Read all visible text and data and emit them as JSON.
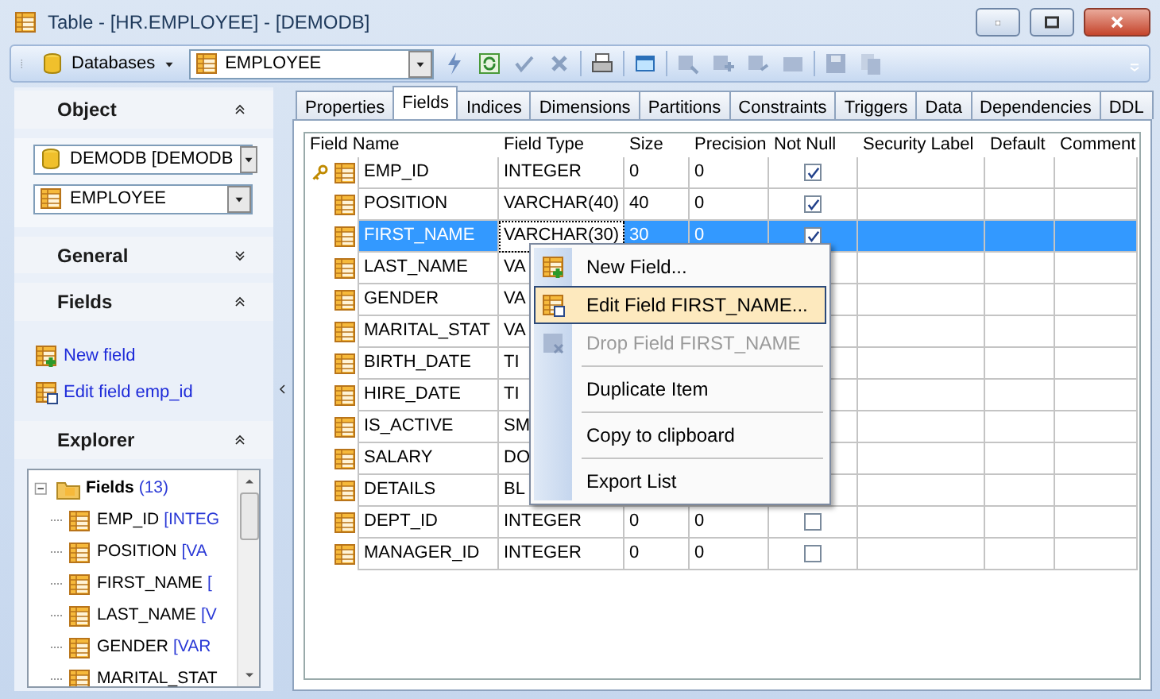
{
  "window": {
    "title": "Table - [HR.EMPLOYEE] - [DEMODB]"
  },
  "toolbar": {
    "databases_label": "Databases",
    "object_combo": "EMPLOYEE"
  },
  "sidebar": {
    "sections": [
      {
        "title": "Object",
        "expanded": true,
        "kind": "object",
        "combos": [
          "DEMODB [DEMODB",
          "EMPLOYEE"
        ]
      },
      {
        "title": "General",
        "expanded": false,
        "kind": "empty"
      },
      {
        "title": "Fields",
        "expanded": true,
        "kind": "links",
        "links": [
          "New field",
          "Edit field emp_id"
        ]
      },
      {
        "title": "Explorer",
        "expanded": true,
        "kind": "tree",
        "tree": {
          "label": "Fields",
          "count": "(13)",
          "expanded": true,
          "children": [
            {
              "label": "EMP_ID",
              "type": "[INTEG"
            },
            {
              "label": "POSITION",
              "type": "[VA"
            },
            {
              "label": "FIRST_NAME",
              "type": "["
            },
            {
              "label": "LAST_NAME",
              "type": "[V"
            },
            {
              "label": "GENDER",
              "type": "[VAR"
            },
            {
              "label": "MARITAL_STAT"
            }
          ]
        }
      }
    ]
  },
  "tabs": [
    {
      "label": "Properties",
      "selected": false
    },
    {
      "label": "Fields",
      "selected": true
    },
    {
      "label": "Indices",
      "selected": false
    },
    {
      "label": "Dimensions",
      "selected": false
    },
    {
      "label": "Partitions",
      "selected": false
    },
    {
      "label": "Constraints",
      "selected": false
    },
    {
      "label": "Triggers",
      "selected": false
    },
    {
      "label": "Data",
      "selected": false
    },
    {
      "label": "Dependencies",
      "selected": false
    },
    {
      "label": "DDL",
      "selected": false
    }
  ],
  "table": {
    "columns": [
      "Field Name",
      "Field Type",
      "Size",
      "Precision",
      "Not Null",
      "Security Label",
      "Default",
      "Comment"
    ],
    "rows": [
      {
        "name": "EMP_ID",
        "type": "INTEGER",
        "size": "0",
        "precision": "0",
        "not_null": true,
        "primary_key": true,
        "selected": false
      },
      {
        "name": "POSITION",
        "type": "VARCHAR(40)",
        "size": "40",
        "precision": "0",
        "not_null": true,
        "primary_key": false,
        "selected": false
      },
      {
        "name": "FIRST_NAME",
        "type": "VARCHAR(30)",
        "size": "30",
        "precision": "0",
        "not_null": true,
        "primary_key": false,
        "selected": true
      },
      {
        "name": "LAST_NAME",
        "type": "VA",
        "primary_key": false,
        "selected": false
      },
      {
        "name": "GENDER",
        "type": "VA",
        "primary_key": false,
        "selected": false
      },
      {
        "name": "MARITAL_STAT",
        "type": "VA",
        "primary_key": false,
        "selected": false
      },
      {
        "name": "BIRTH_DATE",
        "type": "TI",
        "primary_key": false,
        "selected": false
      },
      {
        "name": "HIRE_DATE",
        "type": "TI",
        "primary_key": false,
        "selected": false
      },
      {
        "name": "IS_ACTIVE",
        "type": "SM",
        "primary_key": false,
        "selected": false
      },
      {
        "name": "SALARY",
        "type": "DO",
        "primary_key": false,
        "selected": false
      },
      {
        "name": "DETAILS",
        "type": "BL",
        "primary_key": false,
        "selected": false
      },
      {
        "name": "DEPT_ID",
        "type": "INTEGER",
        "size": "0",
        "precision": "0",
        "not_null": false,
        "primary_key": false,
        "selected": false
      },
      {
        "name": "MANAGER_ID",
        "type": "INTEGER",
        "size": "0",
        "precision": "0",
        "not_null": false,
        "primary_key": false,
        "selected": false
      }
    ]
  },
  "context_menu": {
    "items": [
      {
        "label": "New Field...",
        "disabled": false,
        "highlighted": false,
        "separator_before": false
      },
      {
        "label": "Edit Field FIRST_NAME...",
        "disabled": false,
        "highlighted": true,
        "separator_before": false
      },
      {
        "label": "Drop Field FIRST_NAME",
        "disabled": true,
        "highlighted": false,
        "separator_before": false
      },
      {
        "label": "Duplicate Item",
        "disabled": false,
        "highlighted": false,
        "separator_before": true
      },
      {
        "label": "Copy to clipboard",
        "disabled": false,
        "highlighted": false,
        "separator_before": true
      },
      {
        "label": "Export List",
        "disabled": false,
        "highlighted": false,
        "separator_before": true
      }
    ]
  }
}
